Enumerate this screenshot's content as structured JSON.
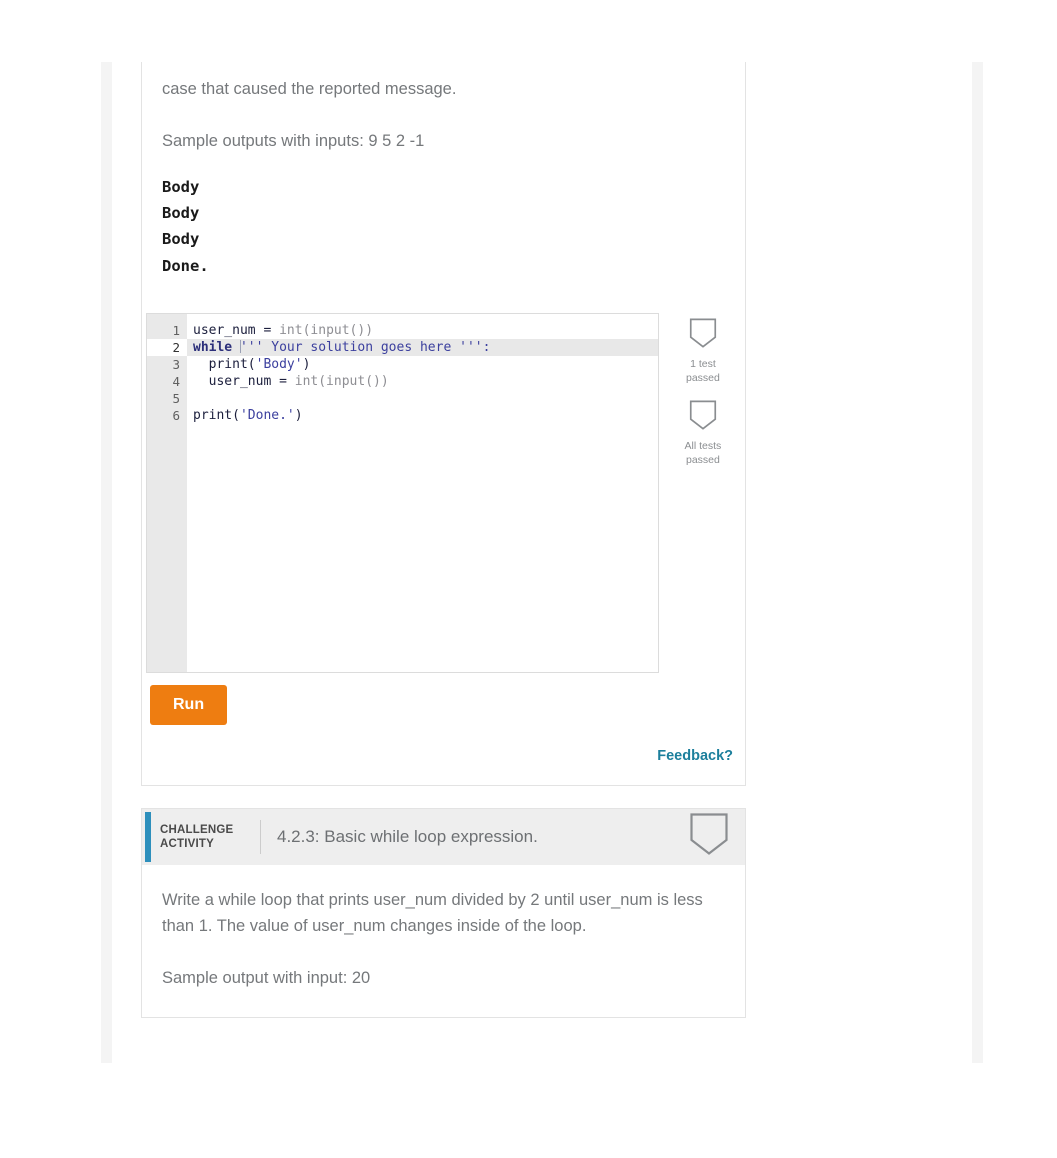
{
  "activity_upper": {
    "paragraphs": [
      "case that caused the reported message.",
      "Sample outputs with inputs: 9 5 2 -1"
    ],
    "sample_output_lines": [
      "Body",
      "Body",
      "Body",
      "Done."
    ],
    "editor": {
      "lines": [
        {
          "num": "1",
          "active": false,
          "tokens": [
            {
              "t": "user_num ",
              "c": "tok-id"
            },
            {
              "t": "= ",
              "c": "tok-plain"
            },
            {
              "t": "int(input())",
              "c": "tok-fn"
            }
          ]
        },
        {
          "num": "2",
          "active": true,
          "tokens": [
            {
              "t": "while ",
              "c": "tok-kw"
            },
            {
              "t": "CARET",
              "c": "caret"
            },
            {
              "t": "''' Your solution goes here ''':",
              "c": "tok-str"
            }
          ]
        },
        {
          "num": "3",
          "active": false,
          "tokens": [
            {
              "t": "  print(",
              "c": "tok-plain"
            },
            {
              "t": "'Body'",
              "c": "tok-str"
            },
            {
              "t": ")",
              "c": "tok-plain"
            }
          ]
        },
        {
          "num": "4",
          "active": false,
          "tokens": [
            {
              "t": "  user_num ",
              "c": "tok-id"
            },
            {
              "t": "= ",
              "c": "tok-plain"
            },
            {
              "t": "int(input())",
              "c": "tok-fn"
            }
          ]
        },
        {
          "num": "5",
          "active": false,
          "tokens": [
            {
              "t": "",
              "c": "tok-plain"
            }
          ]
        },
        {
          "num": "6",
          "active": false,
          "tokens": [
            {
              "t": "print(",
              "c": "tok-plain"
            },
            {
              "t": "'Done.'",
              "c": "tok-str"
            },
            {
              "t": ")",
              "c": "tok-plain"
            }
          ]
        }
      ],
      "plain_text": "user_num = int(input())\nwhile ''' Your solution goes here ''':\n  print('Body')\n  user_num = int(input())\n\nprint('Done.')"
    },
    "tests": [
      {
        "icon": "shield-badge-icon",
        "caption_line1": "1 test",
        "caption_line2": "passed"
      },
      {
        "icon": "shield-badge-icon",
        "caption_line1": "All tests",
        "caption_line2": "passed"
      }
    ],
    "run_label": "Run",
    "feedback_label": "Feedback?"
  },
  "activity_lower": {
    "kicker_line1": "CHALLENGE",
    "kicker_line2": "ACTIVITY",
    "title": "4.2.3: Basic while loop expression.",
    "badge_icon": "shield-badge-icon",
    "paragraphs": [
      "Write a while loop that prints user_num divided by 2 until user_num is less than 1. The value of user_num changes inside of the loop.",
      "Sample output with input: 20"
    ]
  },
  "colors": {
    "accent_blue": "#2d8fbc",
    "run_orange": "#ee7d11",
    "feedback_teal": "#1c7f9c",
    "prose_gray": "#75787b",
    "header_gray": "#eeeeee",
    "gutter_gray": "#e9e9e9",
    "active_line_gray": "#e8e8e8",
    "band_gray": "#f4f4f4"
  }
}
